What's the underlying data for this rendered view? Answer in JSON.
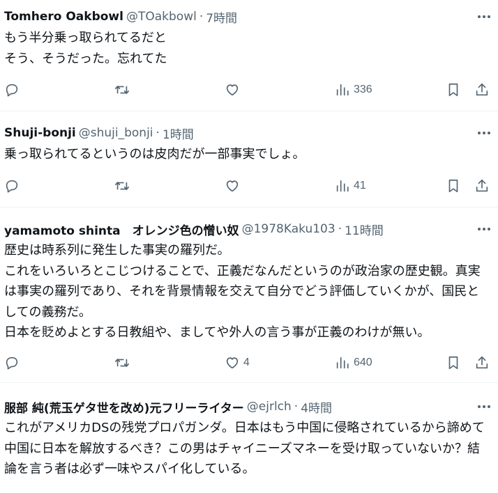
{
  "tweets": [
    {
      "name": "Tomhero Oakbowl",
      "handle": "@TOakbowl",
      "separator": "·",
      "time": "7時間",
      "text": "もう半分乗っ取られてるだと\nそう、そうだった。忘れてた",
      "replies": "",
      "retweets": "",
      "likes": "",
      "views": "336"
    },
    {
      "name": "Shuji-bonji",
      "handle": "@shuji_bonji",
      "separator": "·",
      "time": "1時間",
      "text": "乗っ取られてるというのは皮肉だが一部事実でしょ。",
      "replies": "",
      "retweets": "",
      "likes": "",
      "views": "41"
    },
    {
      "name": "yamamoto shinta　オレンジ色の憎い奴",
      "handle": "@1978Kaku103",
      "separator": "·",
      "time": "11時間",
      "text": "歴史は時系列に発生した事実の羅列だ。\nこれをいろいろとこじつけることで、正義だなんだというのが政治家の歴史観。真実は事実の羅列であり、それを背景情報を交えて自分でどう評価していくかが、国民としての義務だ。\n日本を貶めよとする日教組や、ましてや外人の言う事が正義のわけが無い。",
      "replies": "",
      "retweets": "",
      "likes": "4",
      "views": "640"
    },
    {
      "name": "服部 純(荒玉ゲタ世を改め)元フリーライター",
      "handle": "@ejrlch",
      "separator": "·",
      "time": "4時間",
      "text": "これがアメリカDSの残党プロパガンダ。日本はもう中国に侵略されているから諦めて中国に日本を解放するべき？この男はチャイニーズマネーを受け取っていないか？結論を言う者は必ず一味やスパイ化している。"
    }
  ],
  "icons": {
    "more": "more-horizontal-icon",
    "reply": "reply-icon",
    "retweet": "retweet-icon",
    "like": "heart-icon",
    "views": "views-bar-chart-icon",
    "bookmark": "bookmark-icon",
    "share": "share-icon"
  },
  "colors": {
    "text": "#0f1419",
    "secondary": "#536471",
    "divider": "#eff3f4"
  }
}
